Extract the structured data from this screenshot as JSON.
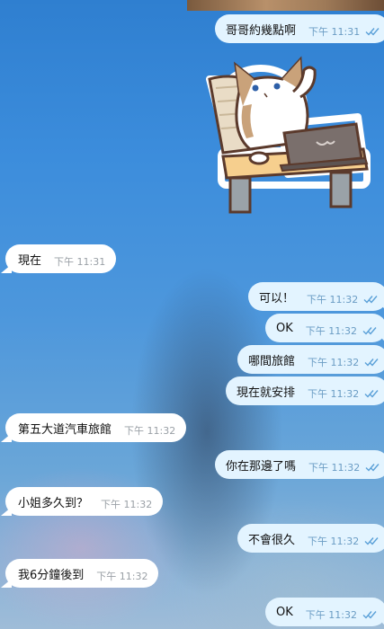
{
  "messages": [
    {
      "text": "哥哥約幾點啊",
      "time": "下午 11:31",
      "direction": "out"
    },
    {
      "type": "sticker",
      "icon": "cat-at-laptop-sticker",
      "direction": "out"
    },
    {
      "text": "現在",
      "time": "下午 11:31",
      "direction": "in"
    },
    {
      "text": "可以！",
      "time": "下午 11:32",
      "direction": "out"
    },
    {
      "text": "OK",
      "time": "下午 11:32",
      "direction": "out"
    },
    {
      "text": "哪間旅館",
      "time": "下午 11:32",
      "direction": "out"
    },
    {
      "text": "現在就安排",
      "time": "下午 11:32",
      "direction": "out"
    },
    {
      "text": "第五大道汽車旅館",
      "time": "下午 11:32",
      "direction": "in"
    },
    {
      "text": "你在那邊了嗎",
      "time": "下午 11:32",
      "direction": "out"
    },
    {
      "text": "小姐多久到？",
      "time": "下午 11:32",
      "direction": "in"
    },
    {
      "text": "不會很久",
      "time": "下午 11:32",
      "direction": "out"
    },
    {
      "text": "我6分鐘後到",
      "time": "下午 11:32",
      "direction": "in"
    },
    {
      "text": "OK",
      "time": "下午 11:32",
      "direction": "out"
    }
  ],
  "colors": {
    "outgoing_bubble": "#e3f4ff",
    "incoming_bubble": "#ffffff",
    "read_ticks": "#5aa0d8"
  },
  "status": {
    "read_icon": "double-check-icon"
  }
}
